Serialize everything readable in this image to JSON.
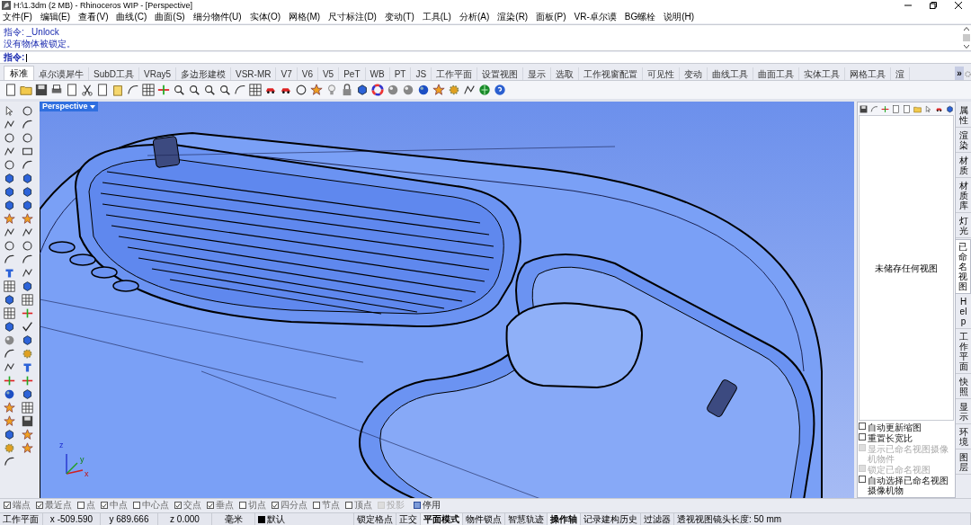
{
  "window": {
    "title": "H:\\1.3dm (2 MB) - Rhinoceros WIP - [Perspective]"
  },
  "menu": [
    "文件(F)",
    "编辑(E)",
    "查看(V)",
    "曲线(C)",
    "曲面(S)",
    "细分物件(U)",
    "实体(O)",
    "网格(M)",
    "尺寸标注(D)",
    "变动(T)",
    "工具(L)",
    "分析(A)",
    "渲染(R)",
    "面板(P)",
    "VR-卓尔谟",
    "BG螺栓",
    "说明(H)"
  ],
  "command_history": [
    "指令: _Unlock",
    "没有物体被锁定。"
  ],
  "command_prompt": {
    "label": "指令:"
  },
  "toolbar_tabs": [
    {
      "label": "标准",
      "selected": true
    },
    {
      "label": "卓尔谟犀牛",
      "selected": false
    },
    {
      "label": "SubD工具",
      "selected": false
    },
    {
      "label": "VRay5",
      "selected": false
    },
    {
      "label": "多边形建模",
      "selected": false
    },
    {
      "label": "VSR-MR",
      "selected": false
    },
    {
      "label": "V7",
      "selected": false
    },
    {
      "label": "V6",
      "selected": false
    },
    {
      "label": "V5",
      "selected": false
    },
    {
      "label": "PeT",
      "selected": false
    },
    {
      "label": "WB",
      "selected": false
    },
    {
      "label": "PT",
      "selected": false
    },
    {
      "label": "JS",
      "selected": false
    },
    {
      "label": "工作平面",
      "selected": false
    },
    {
      "label": "设置视图",
      "selected": false
    },
    {
      "label": "显示",
      "selected": false
    },
    {
      "label": "选取",
      "selected": false
    },
    {
      "label": "工作视窗配置",
      "selected": false
    },
    {
      "label": "可见性",
      "selected": false
    },
    {
      "label": "变动",
      "selected": false
    },
    {
      "label": "曲线工具",
      "selected": false
    },
    {
      "label": "曲面工具",
      "selected": false
    },
    {
      "label": "实体工具",
      "selected": false
    },
    {
      "label": "网格工具",
      "selected": false
    },
    {
      "label": "渲",
      "selected": false
    }
  ],
  "tabs_overflow": "»",
  "viewport": {
    "label": "Perspective",
    "axes": [
      "z",
      "y",
      "x"
    ]
  },
  "named_views_panel": {
    "empty_message": "未储存任何视图",
    "options": [
      {
        "label": "自动更新缩图",
        "checked": false,
        "disabled": false
      },
      {
        "label": "重置长宽比",
        "checked": false,
        "disabled": false
      },
      {
        "label": "显示已命名视图摄像机物件",
        "checked": false,
        "disabled": true
      },
      {
        "label": "锁定已命名视图",
        "checked": false,
        "disabled": true
      },
      {
        "label": "自动选择已命名视图摄像机物",
        "checked": false,
        "disabled": false
      }
    ]
  },
  "side_tabs": [
    {
      "label": "属性",
      "selected": false
    },
    {
      "label": "渲染",
      "selected": false
    },
    {
      "label": "材质",
      "selected": false
    },
    {
      "label": "材质库",
      "selected": false
    },
    {
      "label": "灯光",
      "selected": false
    },
    {
      "label": "已命名视图",
      "selected": true
    },
    {
      "label": "Help",
      "selected": false
    },
    {
      "label": "工作平面",
      "selected": false
    },
    {
      "label": "快照",
      "selected": false
    },
    {
      "label": "显示",
      "selected": false
    },
    {
      "label": "环境",
      "selected": false
    },
    {
      "label": "图层",
      "selected": false
    }
  ],
  "osnaps": [
    {
      "label": "端点",
      "checked": true,
      "disabled": false
    },
    {
      "label": "最近点",
      "checked": true,
      "disabled": false
    },
    {
      "label": "点",
      "checked": false,
      "disabled": false
    },
    {
      "label": "中点",
      "checked": true,
      "disabled": false
    },
    {
      "label": "中心点",
      "checked": false,
      "disabled": false
    },
    {
      "label": "交点",
      "checked": true,
      "disabled": false
    },
    {
      "label": "垂点",
      "checked": true,
      "disabled": false
    },
    {
      "label": "切点",
      "checked": false,
      "disabled": false
    },
    {
      "label": "四分点",
      "checked": true,
      "disabled": false
    },
    {
      "label": "节点",
      "checked": false,
      "disabled": false
    },
    {
      "label": "顶点",
      "checked": false,
      "disabled": false
    },
    {
      "label": "投影",
      "checked": false,
      "disabled": true
    }
  ],
  "osnap_disable": {
    "label": "停用",
    "checked": false
  },
  "status_bar": {
    "cplane": "工作平面",
    "x": "x -509.590",
    "y": "y 689.666",
    "z": "z 0.000",
    "units": "毫米",
    "layer": {
      "name": "默认",
      "color": "#000000"
    },
    "toggles": [
      {
        "label": "锁定格点",
        "on": false
      },
      {
        "label": "正交",
        "on": false
      },
      {
        "label": "平面模式",
        "on": true
      },
      {
        "label": "物件锁点",
        "on": false
      },
      {
        "label": "智慧轨迹",
        "on": false
      },
      {
        "label": "操作轴",
        "on": true
      },
      {
        "label": "记录建构历史",
        "on": false
      },
      {
        "label": "过滤器",
        "on": false
      }
    ],
    "message": "透视视图镜头长度: 50 mm"
  }
}
